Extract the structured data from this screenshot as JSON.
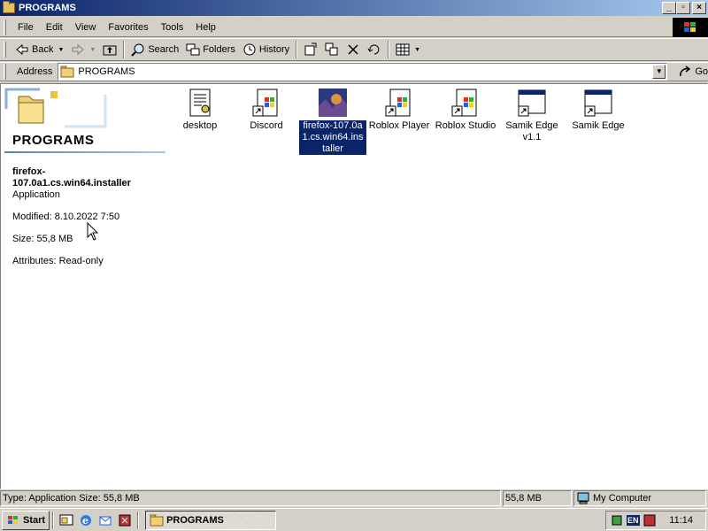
{
  "window": {
    "title": "PROGRAMS"
  },
  "menu": [
    "File",
    "Edit",
    "View",
    "Favorites",
    "Tools",
    "Help"
  ],
  "toolbar": {
    "back": "Back",
    "search": "Search",
    "folders": "Folders",
    "history": "History"
  },
  "address": {
    "label": "Address",
    "value": "PROGRAMS",
    "go": "Go"
  },
  "left_pane": {
    "title": "PROGRAMS",
    "selected_name": "firefox-107.0a1.cs.win64.installer",
    "selected_type": "Application",
    "modified": "Modified: 8.10.2022 7:50",
    "size": "Size: 55,8 MB",
    "attributes": "Attributes: Read-only"
  },
  "files": [
    {
      "name": "desktop",
      "icon": "text-document-icon",
      "selected": false
    },
    {
      "name": "Discord",
      "icon": "shortcut-app-icon",
      "selected": false
    },
    {
      "name": "firefox-107.0a1.cs.win64.installer",
      "label_lines": [
        "firefox-107.0a",
        "1.cs.win64.ins",
        "taller"
      ],
      "icon": "installer-icon",
      "selected": true
    },
    {
      "name": "Roblox Player",
      "icon": "shortcut-app-icon",
      "selected": false
    },
    {
      "name": "Roblox Studio",
      "icon": "shortcut-app-icon",
      "selected": false
    },
    {
      "name": "Samik Edge v1.1",
      "label_lines": [
        "Samik Edge",
        "v1.1"
      ],
      "icon": "shortcut-window-icon",
      "selected": false
    },
    {
      "name": "Samik Edge",
      "icon": "shortcut-window-icon",
      "selected": false
    }
  ],
  "status": {
    "left": "Type: Application Size: 55,8 MB",
    "size": "55,8 MB",
    "zone": "My Computer"
  },
  "taskbar": {
    "start": "Start",
    "task": "PROGRAMS",
    "lang": "EN",
    "clock": "11:14"
  },
  "colors": {
    "titlebar": "#0a246a",
    "selection": "#0a246a",
    "face": "#d4d0c8"
  }
}
